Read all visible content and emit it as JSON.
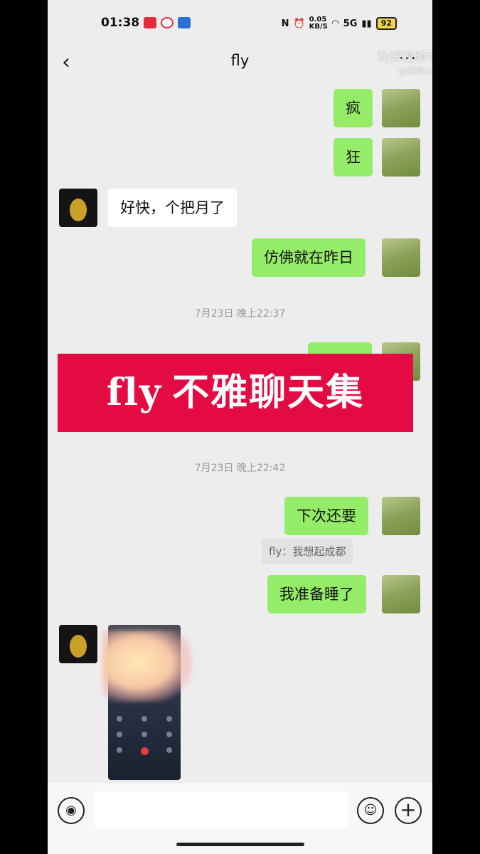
{
  "status_bar": {
    "time": "01:38",
    "network_speed": "0.05 KB/S",
    "signal": "5G",
    "battery": "92"
  },
  "header": {
    "back_icon": "‹",
    "title": "fly",
    "more_icon": "···"
  },
  "watermark": {
    "line1": "微博视频号",
    "line2": "@通讯bot"
  },
  "messages": [
    {
      "from": "me",
      "text": "疯"
    },
    {
      "from": "me",
      "text": "狂"
    },
    {
      "from": "them",
      "text": "好快，个把月了"
    },
    {
      "from": "me",
      "text": "仿佛就在昨日"
    }
  ],
  "timestamp1": "7月23日 晚上22:37",
  "banner": {
    "fly": "fly",
    "text": "不雅聊天集"
  },
  "timestamp2": "7月23日 晚上22:42",
  "messages2": [
    {
      "from": "me",
      "text": "下次还要"
    },
    {
      "from": "me",
      "text": "我准备睡了"
    }
  ],
  "quote": "fly：我想起成都",
  "colors": {
    "chat_bg": "#ededed",
    "my_bubble": "#95ec69",
    "their_bubble": "#ffffff",
    "banner_bg": "#e30b42"
  }
}
